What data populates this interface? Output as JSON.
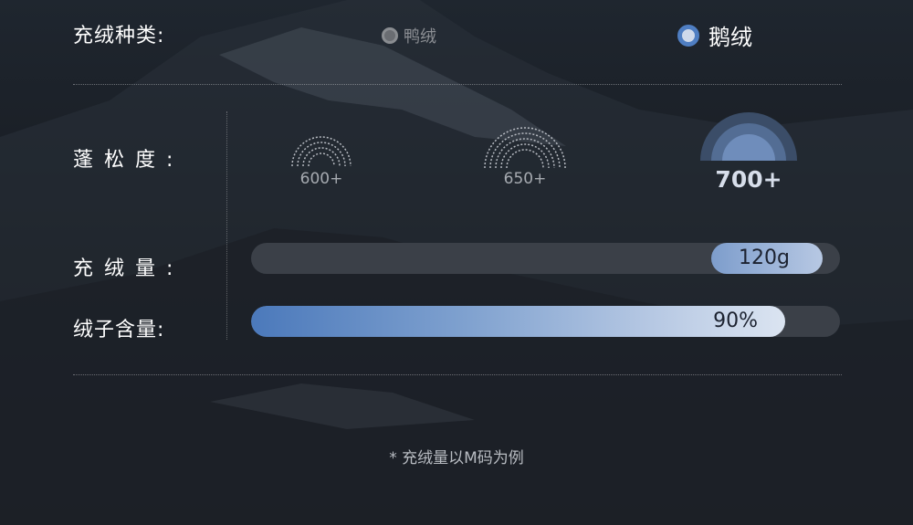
{
  "fill_type": {
    "label": "充绒种类:",
    "options": [
      {
        "label": "鸭绒",
        "selected": false
      },
      {
        "label": "鹅绒",
        "selected": true
      }
    ]
  },
  "loft": {
    "label": "蓬松度:",
    "options": [
      {
        "label": "600+",
        "selected": false
      },
      {
        "label": "650+",
        "selected": false
      },
      {
        "label": "700+",
        "selected": true
      }
    ]
  },
  "fill_weight": {
    "label": "充绒量:",
    "value": "120g",
    "level": 0.97
  },
  "down_content": {
    "label": "绒子含量:",
    "value": "90%",
    "level": 0.9
  },
  "footnote": "* 充绒量以M码为例",
  "colors": {
    "accent": "#4f7ec2",
    "track": "#3b4048",
    "background": "#181c22"
  }
}
